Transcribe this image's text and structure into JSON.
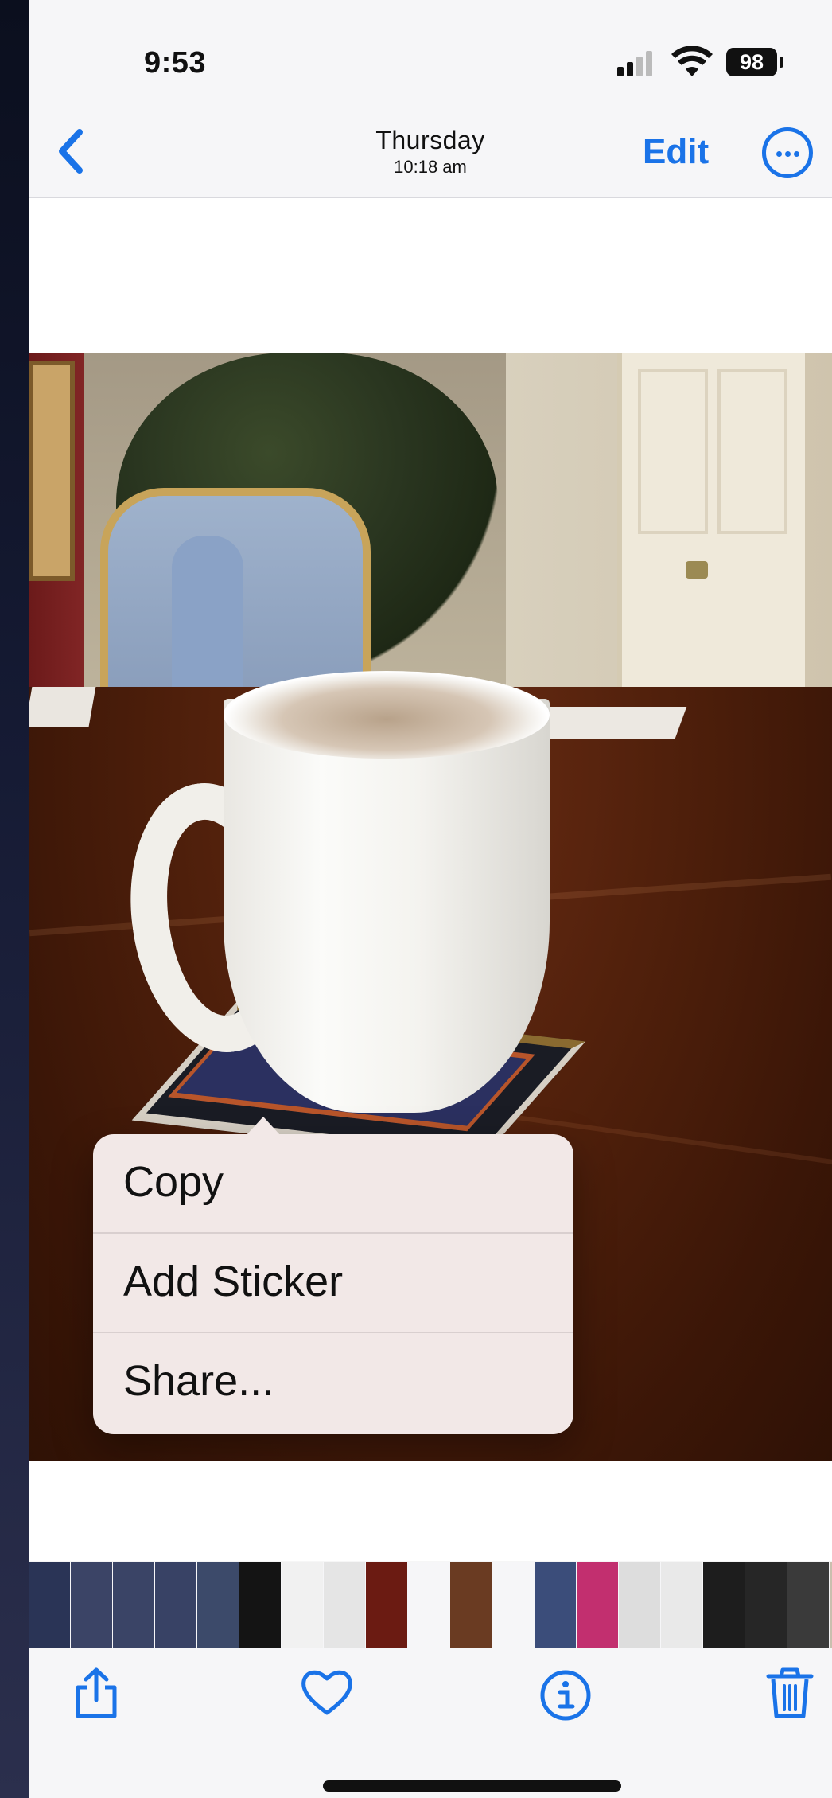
{
  "status_bar": {
    "time": "9:53",
    "battery": "98"
  },
  "nav": {
    "day": "Thursday",
    "time": "10:18 am",
    "edit_label": "Edit",
    "back_icon": "chevron-left-icon",
    "more_icon": "ellipsis-circle-icon"
  },
  "context_menu": {
    "items": [
      {
        "label": "Copy"
      },
      {
        "label": "Add Sticker"
      },
      {
        "label": "Share..."
      }
    ]
  },
  "thumbnail_strip": {
    "colors": [
      "#2a3456",
      "#3b4466",
      "#3a4466",
      "#384265",
      "#3c4a6a",
      "#141414",
      "#f1f1f1",
      "#e5e5e5",
      "#6b1b12",
      "#f6f6f8",
      "#6a3b22",
      "#f6f6f8",
      "#3b4d7a",
      "#c22f6f",
      "#dddddd",
      "#e9e9e9",
      "#1d1d1d",
      "#262626",
      "#3a3a3a",
      "#c9bfae",
      "#d7d7d7"
    ]
  },
  "toolbar": {
    "share_icon": "share-icon",
    "favorite_icon": "heart-icon",
    "info_icon": "info-icon",
    "delete_icon": "trash-icon"
  },
  "colors": {
    "accent": "#1a73e8",
    "menu_bg": "#f2e8e7"
  }
}
